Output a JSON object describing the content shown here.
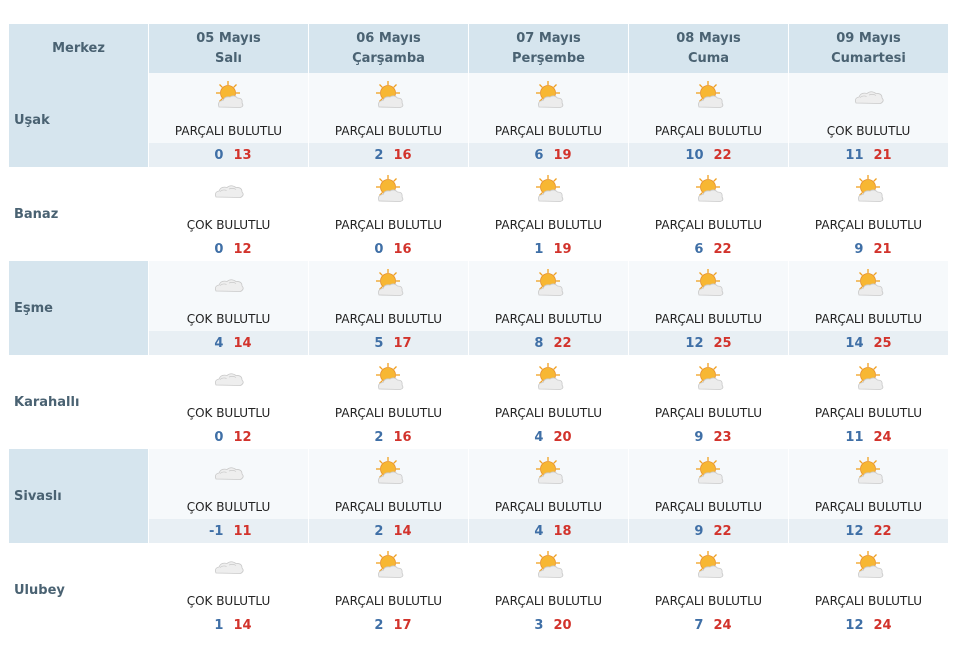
{
  "header": {
    "city_label": "Merkez",
    "days": [
      {
        "date": "05 Mayıs",
        "weekday": "Salı"
      },
      {
        "date": "06 Mayıs",
        "weekday": "Çarşamba"
      },
      {
        "date": "07 Mayıs",
        "weekday": "Perşembe"
      },
      {
        "date": "08 Mayıs",
        "weekday": "Cuma"
      },
      {
        "date": "09 Mayıs",
        "weekday": "Cumartesi"
      }
    ]
  },
  "colors": {
    "header_bg": "#d6e5ee",
    "min_temp": "#3f6fa6",
    "max_temp": "#d2332c",
    "sun": "#f5a623",
    "cloud": "#e4e4e4"
  },
  "rows": [
    {
      "city": "Uşak",
      "days": [
        {
          "icon": "partly-cloudy-icon",
          "condition": "PARÇALI BULUTLU",
          "min": "0",
          "max": "13"
        },
        {
          "icon": "partly-cloudy-icon",
          "condition": "PARÇALI BULUTLU",
          "min": "2",
          "max": "16"
        },
        {
          "icon": "partly-cloudy-icon",
          "condition": "PARÇALI BULUTLU",
          "min": "6",
          "max": "19"
        },
        {
          "icon": "partly-cloudy-icon",
          "condition": "PARÇALI BULUTLU",
          "min": "10",
          "max": "22"
        },
        {
          "icon": "cloudy-icon",
          "condition": "ÇOK BULUTLU",
          "min": "11",
          "max": "21"
        }
      ]
    },
    {
      "city": "Banaz",
      "days": [
        {
          "icon": "cloudy-icon",
          "condition": "ÇOK BULUTLU",
          "min": "0",
          "max": "12"
        },
        {
          "icon": "partly-cloudy-icon",
          "condition": "PARÇALI BULUTLU",
          "min": "0",
          "max": "16"
        },
        {
          "icon": "partly-cloudy-icon",
          "condition": "PARÇALI BULUTLU",
          "min": "1",
          "max": "19"
        },
        {
          "icon": "partly-cloudy-icon",
          "condition": "PARÇALI BULUTLU",
          "min": "6",
          "max": "22"
        },
        {
          "icon": "partly-cloudy-icon",
          "condition": "PARÇALI BULUTLU",
          "min": "9",
          "max": "21"
        }
      ]
    },
    {
      "city": "Eşme",
      "days": [
        {
          "icon": "cloudy-icon",
          "condition": "ÇOK BULUTLU",
          "min": "4",
          "max": "14"
        },
        {
          "icon": "partly-cloudy-icon",
          "condition": "PARÇALI BULUTLU",
          "min": "5",
          "max": "17"
        },
        {
          "icon": "partly-cloudy-icon",
          "condition": "PARÇALI BULUTLU",
          "min": "8",
          "max": "22"
        },
        {
          "icon": "partly-cloudy-icon",
          "condition": "PARÇALI BULUTLU",
          "min": "12",
          "max": "25"
        },
        {
          "icon": "partly-cloudy-icon",
          "condition": "PARÇALI BULUTLU",
          "min": "14",
          "max": "25"
        }
      ]
    },
    {
      "city": "Karahallı",
      "days": [
        {
          "icon": "cloudy-icon",
          "condition": "ÇOK BULUTLU",
          "min": "0",
          "max": "12"
        },
        {
          "icon": "partly-cloudy-icon",
          "condition": "PARÇALI BULUTLU",
          "min": "2",
          "max": "16"
        },
        {
          "icon": "partly-cloudy-icon",
          "condition": "PARÇALI BULUTLU",
          "min": "4",
          "max": "20"
        },
        {
          "icon": "partly-cloudy-icon",
          "condition": "PARÇALI BULUTLU",
          "min": "9",
          "max": "23"
        },
        {
          "icon": "partly-cloudy-icon",
          "condition": "PARÇALI BULUTLU",
          "min": "11",
          "max": "24"
        }
      ]
    },
    {
      "city": "Sivaslı",
      "days": [
        {
          "icon": "cloudy-icon",
          "condition": "ÇOK BULUTLU",
          "min": "-1",
          "max": "11"
        },
        {
          "icon": "partly-cloudy-icon",
          "condition": "PARÇALI BULUTLU",
          "min": "2",
          "max": "14"
        },
        {
          "icon": "partly-cloudy-icon",
          "condition": "PARÇALI BULUTLU",
          "min": "4",
          "max": "18"
        },
        {
          "icon": "partly-cloudy-icon",
          "condition": "PARÇALI BULUTLU",
          "min": "9",
          "max": "22"
        },
        {
          "icon": "partly-cloudy-icon",
          "condition": "PARÇALI BULUTLU",
          "min": "12",
          "max": "22"
        }
      ]
    },
    {
      "city": "Ulubey",
      "days": [
        {
          "icon": "cloudy-icon",
          "condition": "ÇOK BULUTLU",
          "min": "1",
          "max": "14"
        },
        {
          "icon": "partly-cloudy-icon",
          "condition": "PARÇALI BULUTLU",
          "min": "2",
          "max": "17"
        },
        {
          "icon": "partly-cloudy-icon",
          "condition": "PARÇALI BULUTLU",
          "min": "3",
          "max": "20"
        },
        {
          "icon": "partly-cloudy-icon",
          "condition": "PARÇALI BULUTLU",
          "min": "7",
          "max": "24"
        },
        {
          "icon": "partly-cloudy-icon",
          "condition": "PARÇALI BULUTLU",
          "min": "12",
          "max": "24"
        }
      ]
    }
  ]
}
